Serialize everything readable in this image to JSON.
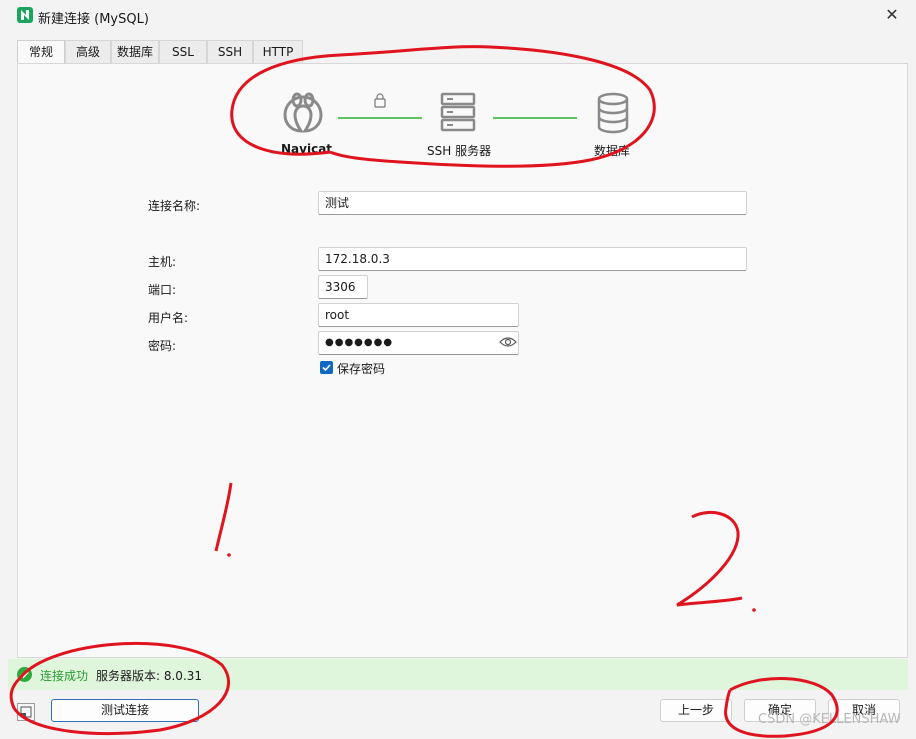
{
  "window": {
    "title": "新建连接 (MySQL)"
  },
  "tabs": [
    {
      "label": "常规",
      "active": true
    },
    {
      "label": "高级"
    },
    {
      "label": "数据库"
    },
    {
      "label": "SSL"
    },
    {
      "label": "SSH"
    },
    {
      "label": "HTTP"
    }
  ],
  "diagram": {
    "navicat_label": "Navicat",
    "ssh_label": "SSH 服务器",
    "db_label": "数据库"
  },
  "form": {
    "conn_name_label": "连接名称:",
    "conn_name_value": "测试",
    "host_label": "主机:",
    "host_value": "172.18.0.3",
    "port_label": "端口:",
    "port_value": "3306",
    "user_label": "用户名:",
    "user_value": "root",
    "password_label": "密码:",
    "password_value": "●●●●●●●",
    "save_password_label": "保存密码",
    "save_password_checked": true
  },
  "status": {
    "message": "连接成功",
    "version": "服务器版本: 8.0.31"
  },
  "buttons": {
    "test": "测试连接",
    "prev": "上一步",
    "ok": "确定",
    "cancel": "取消"
  },
  "annotations": {
    "one": "1.",
    "two": "2."
  },
  "watermark": "CSDN @KELLENSHAW",
  "colors": {
    "accent": "#1168c4",
    "success": "#2eaa3c",
    "success_bg": "#dff5dc",
    "annotation": "#e0141e",
    "link_line": "#5ec25e"
  }
}
